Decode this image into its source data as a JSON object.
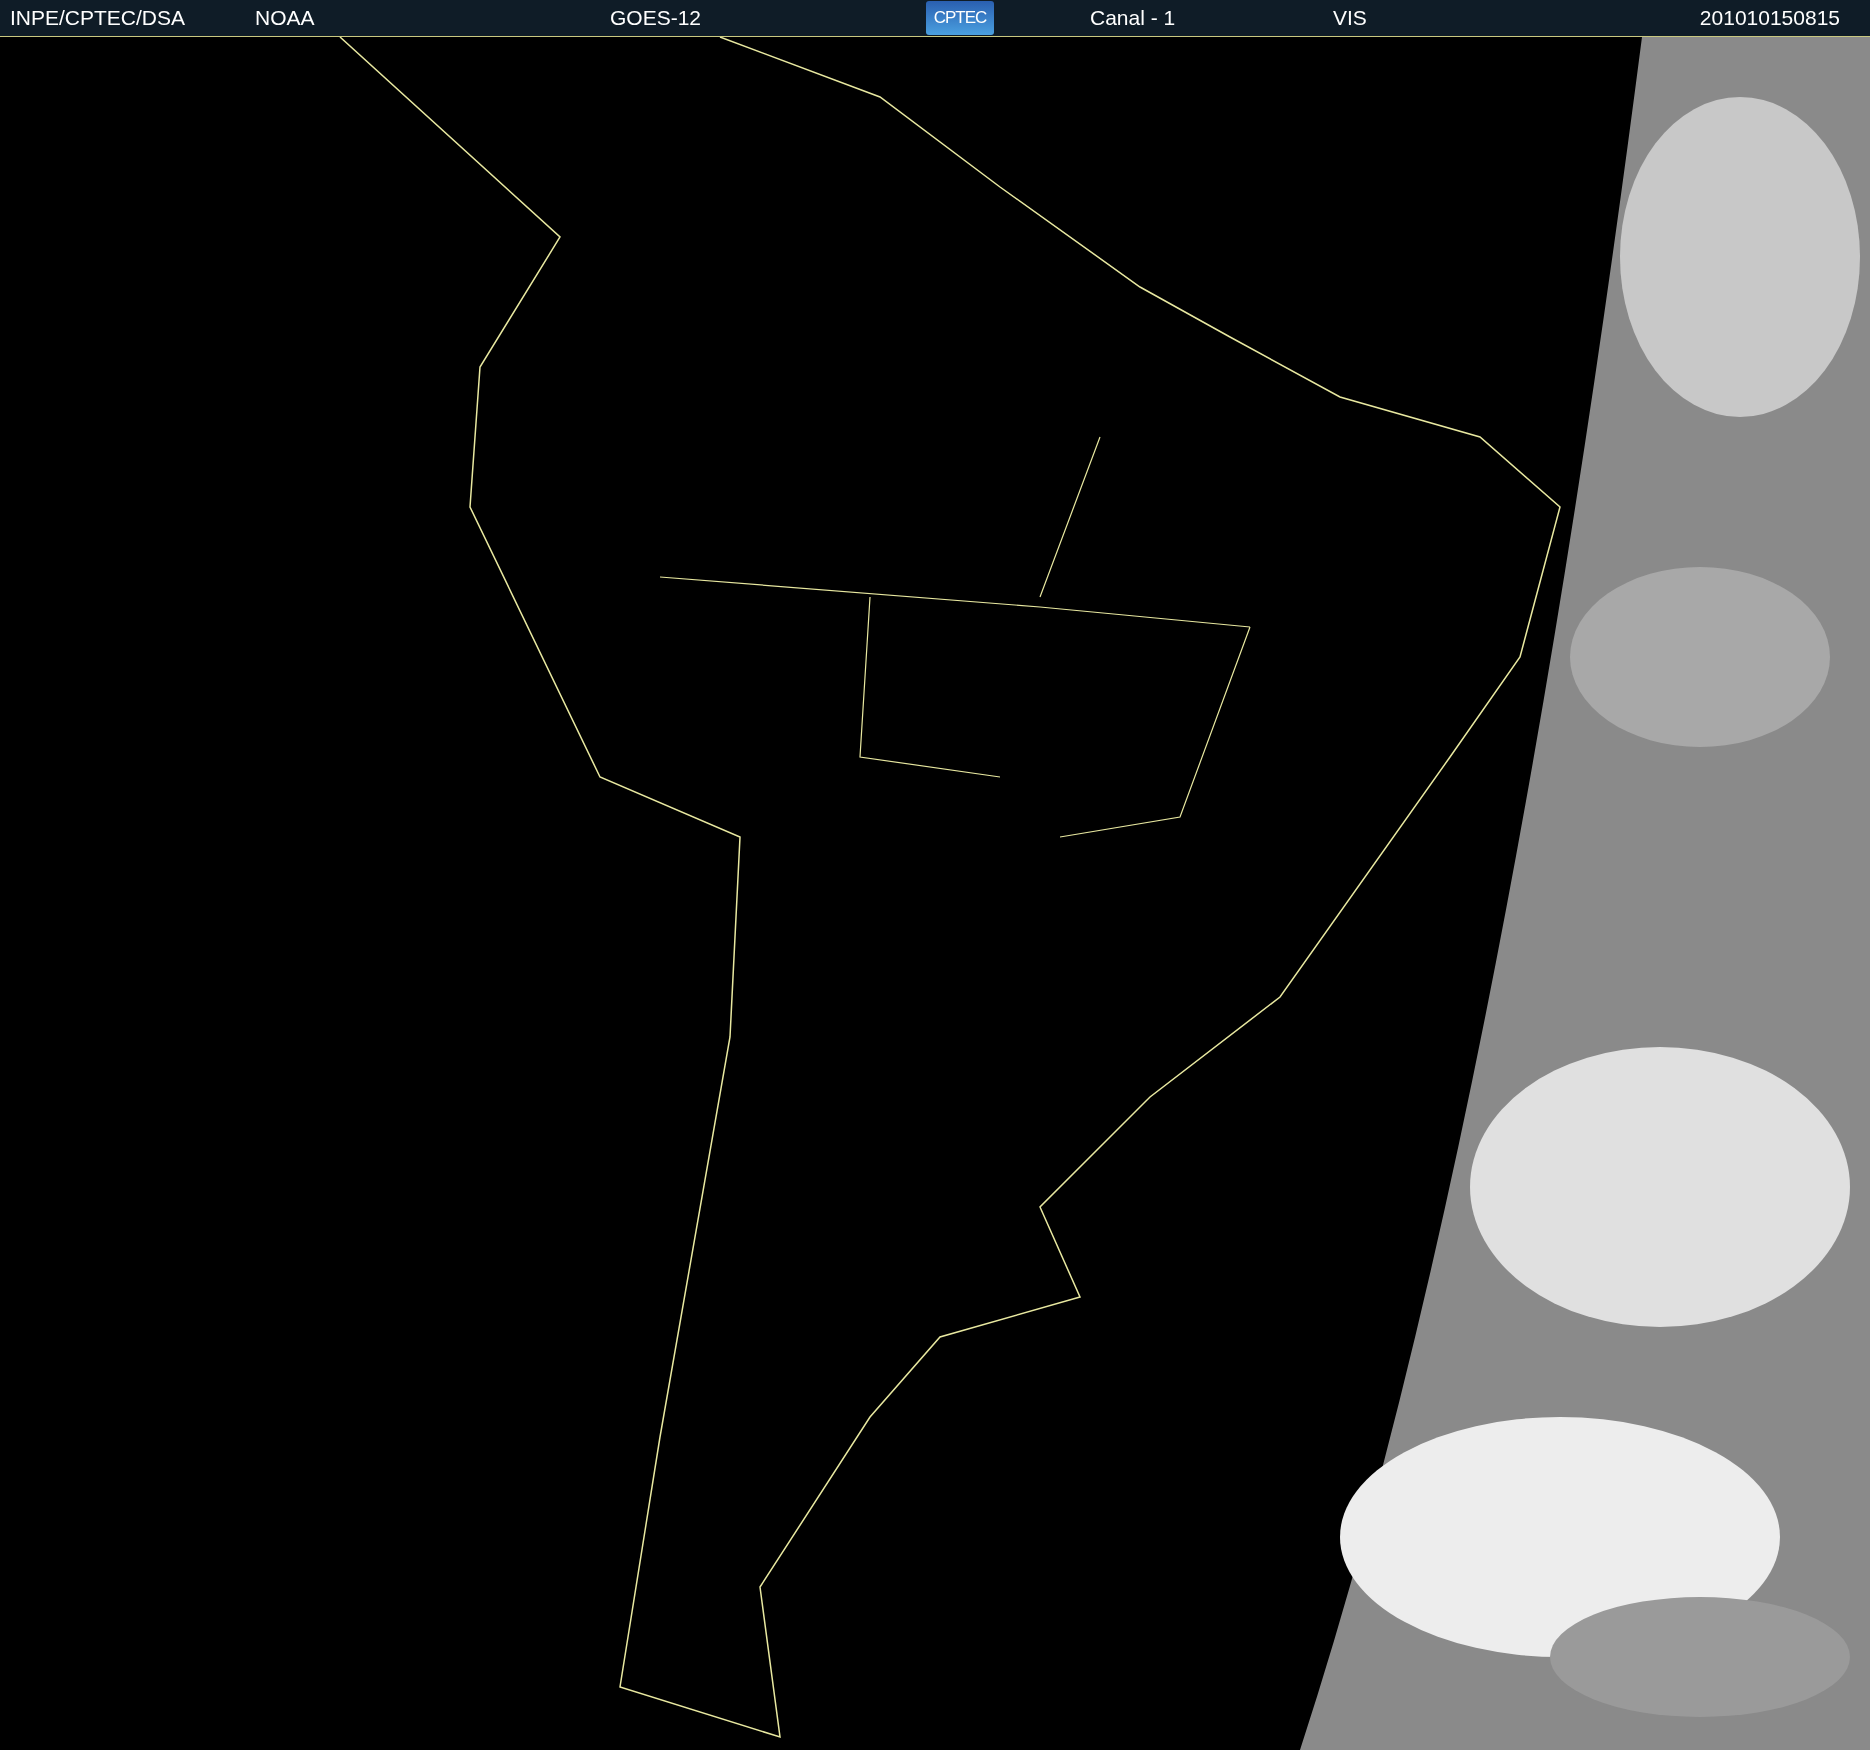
{
  "header": {
    "source": "INPE/CPTEC/DSA",
    "agency": "NOAA",
    "satellite": "GOES-12",
    "logo": "CPTEC",
    "channel": "Canal - 1",
    "band": "VIS",
    "timestamp": "201010150815"
  }
}
